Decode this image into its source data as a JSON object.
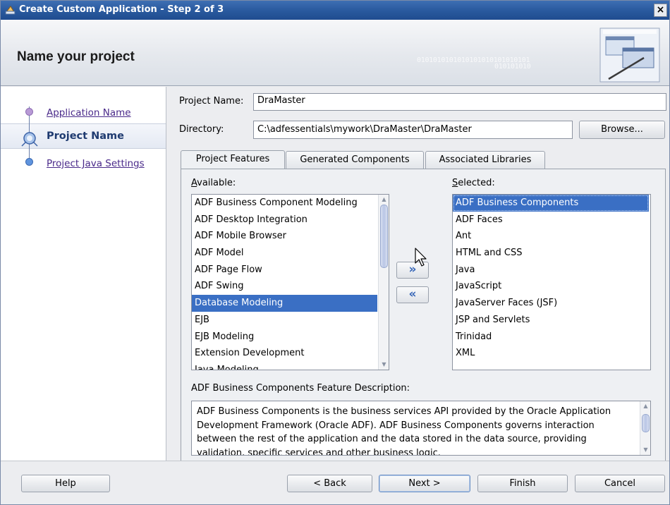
{
  "window": {
    "title": "Create Custom Application - Step 2 of 3",
    "close_glyph": "×"
  },
  "banner": {
    "heading": "Name your project",
    "binary_line1": "0101010101010101010101010101",
    "binary_line2": "010101010"
  },
  "steps": [
    {
      "label": "Application Name",
      "state": "done"
    },
    {
      "label": "Project Name",
      "state": "current"
    },
    {
      "label": "Project Java Settings",
      "state": "todo"
    }
  ],
  "form": {
    "project_name_label": "Project Name:",
    "project_name_value": "DraMaster",
    "directory_label": "Directory:",
    "directory_value": "C:\\adfessentials\\mywork\\DraMaster\\DraMaster",
    "browse_label": "Browse..."
  },
  "tabs": [
    {
      "label": "Project Features",
      "active": true
    },
    {
      "label": "Generated Components",
      "active": false
    },
    {
      "label": "Associated Libraries",
      "active": false
    }
  ],
  "available": {
    "label": "Available:",
    "items": [
      "ADF Business Component Modeling",
      "ADF Desktop Integration",
      "ADF Mobile Browser",
      "ADF Model",
      "ADF Page Flow",
      "ADF Swing",
      "Database Modeling",
      "EJB",
      "EJB Modeling",
      "Extension Development",
      "Java Modeling"
    ],
    "selected_item": "Database Modeling"
  },
  "selected": {
    "label": "Selected:",
    "items": [
      "ADF Business Components",
      "ADF Faces",
      "Ant",
      "HTML and CSS",
      "Java",
      "JavaScript",
      "JavaServer Faces (JSF)",
      "JSP and Servlets",
      "Trinidad",
      "XML"
    ],
    "selected_item": "ADF Business Components"
  },
  "shuttle": {
    "add_glyph": "»",
    "remove_glyph": "«"
  },
  "description": {
    "label": "ADF Business Components Feature Description:",
    "text": "ADF Business Components is the business services API provided by the Oracle Application Development Framework (Oracle ADF).  ADF Business Components governs interaction between the rest of the application and the data stored in the data source, providing validation, specific services and other business logic."
  },
  "footer": {
    "help": "Help",
    "back": "< Back",
    "next": "Next >",
    "finish": "Finish",
    "cancel": "Cancel"
  },
  "colors": {
    "selection": "#3a6fc4",
    "titlebar": "#2a5a9f",
    "link": "#4a2a8a"
  }
}
